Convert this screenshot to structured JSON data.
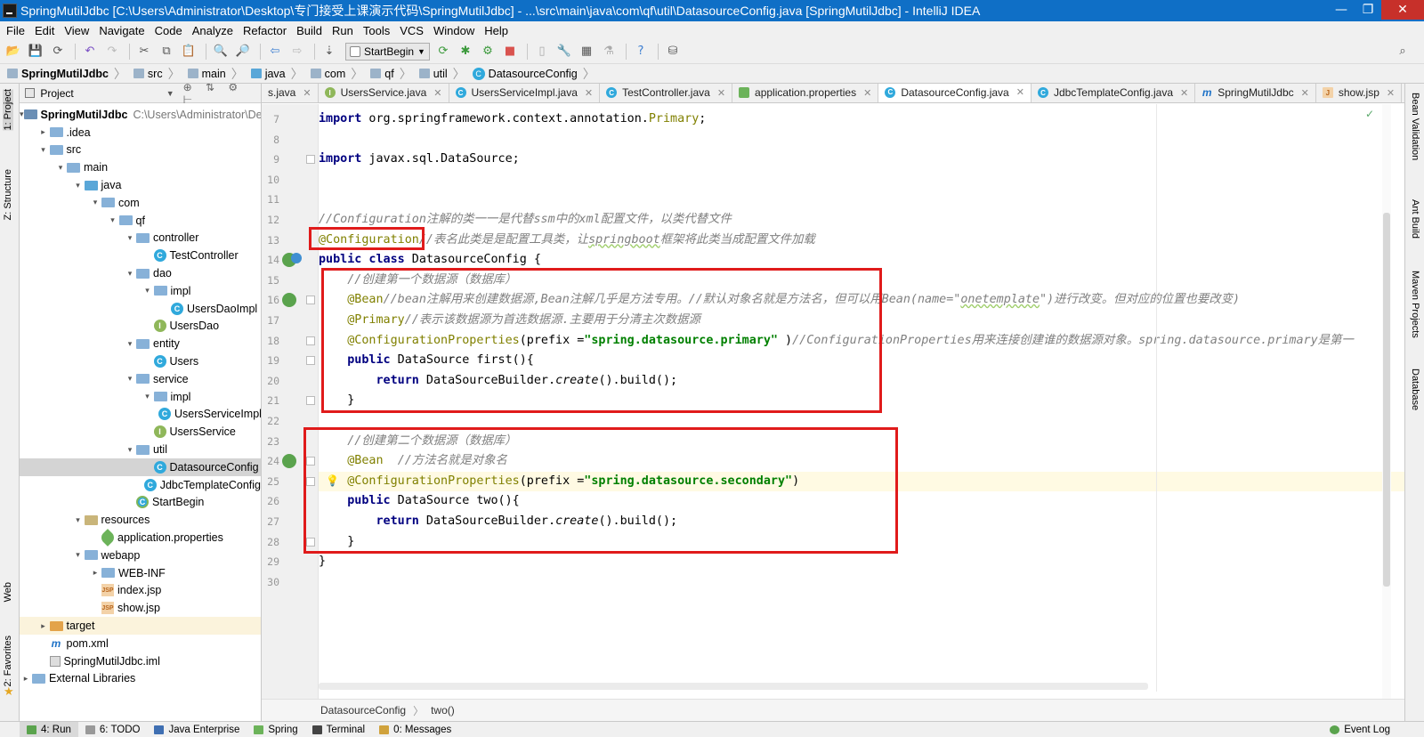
{
  "window": {
    "title": "SpringMutilJdbc [C:\\Users\\Administrator\\Desktop\\专门接受上课演示代码\\SpringMutilJdbc] - ...\\src\\main\\java\\com\\qf\\util\\DatasourceConfig.java [SpringMutilJdbc] - IntelliJ IDEA",
    "minimize": "—",
    "maximize": "❐",
    "close": "✕"
  },
  "menu": [
    "File",
    "Edit",
    "View",
    "Navigate",
    "Code",
    "Analyze",
    "Refactor",
    "Build",
    "Run",
    "Tools",
    "VCS",
    "Window",
    "Help"
  ],
  "toolbar": {
    "run_config": "StartBegin",
    "icons": [
      "open-icon",
      "save-icon",
      "sync-icon",
      "undo-icon",
      "redo-icon",
      "cut-icon",
      "copy-icon",
      "paste-icon",
      "find-icon",
      "replace-icon",
      "back-icon",
      "forward-icon",
      "make-icon",
      "run-icon",
      "debug-icon",
      "coverage-icon",
      "stop-icon",
      "settings-icon",
      "structure-icon",
      "sdk-icon",
      "help-icon",
      "vcs-icon",
      "search-icon"
    ]
  },
  "breadcrumb": [
    "SpringMutilJdbc",
    "src",
    "main",
    "java",
    "com",
    "qf",
    "util",
    "DatasourceConfig"
  ],
  "left_strip": {
    "project": "1: Project",
    "structure": "Z: Structure",
    "web": "Web",
    "favorites": "2: Favorites"
  },
  "right_strip": [
    "Bean Validation",
    "Ant Build",
    "Maven Projects",
    "Database"
  ],
  "project_panel": {
    "title": "Project",
    "tree": [
      {
        "label": "SpringMutilJdbc",
        "path": "C:\\Users\\Administrator\\Deskto",
        "depth": 0,
        "icon": "module-folder-icon",
        "arrow": "▾"
      },
      {
        "label": ".idea",
        "depth": 1,
        "icon": "folder-icon",
        "arrow": "▸"
      },
      {
        "label": "src",
        "depth": 1,
        "icon": "folder-icon",
        "arrow": "▾"
      },
      {
        "label": "main",
        "depth": 2,
        "icon": "folder-icon",
        "arrow": "▾"
      },
      {
        "label": "java",
        "depth": 3,
        "icon": "source-folder-icon",
        "arrow": "▾"
      },
      {
        "label": "com",
        "depth": 4,
        "icon": "package-icon",
        "arrow": "▾"
      },
      {
        "label": "qf",
        "depth": 5,
        "icon": "package-icon",
        "arrow": "▾"
      },
      {
        "label": "controller",
        "depth": 6,
        "icon": "package-icon",
        "arrow": "▾"
      },
      {
        "label": "TestController",
        "depth": 7,
        "icon": "class-icon",
        "arrow": ""
      },
      {
        "label": "dao",
        "depth": 6,
        "icon": "package-icon",
        "arrow": "▾"
      },
      {
        "label": "impl",
        "depth": 7,
        "icon": "package-icon",
        "arrow": "▾"
      },
      {
        "label": "UsersDaoImpl",
        "depth": 8,
        "icon": "class-icon",
        "arrow": ""
      },
      {
        "label": "UsersDao",
        "depth": 7,
        "icon": "interface-icon",
        "arrow": ""
      },
      {
        "label": "entity",
        "depth": 6,
        "icon": "package-icon",
        "arrow": "▾"
      },
      {
        "label": "Users",
        "depth": 7,
        "icon": "class-icon",
        "arrow": ""
      },
      {
        "label": "service",
        "depth": 6,
        "icon": "package-icon",
        "arrow": "▾"
      },
      {
        "label": "impl",
        "depth": 7,
        "icon": "package-icon",
        "arrow": "▾"
      },
      {
        "label": "UsersServiceImpl",
        "depth": 8,
        "icon": "class-icon",
        "arrow": ""
      },
      {
        "label": "UsersService",
        "depth": 7,
        "icon": "interface-icon",
        "arrow": ""
      },
      {
        "label": "util",
        "depth": 6,
        "icon": "package-icon",
        "arrow": "▾"
      },
      {
        "label": "DatasourceConfig",
        "depth": 7,
        "icon": "class-icon",
        "arrow": "",
        "selected": true
      },
      {
        "label": "JdbcTemplateConfig",
        "depth": 7,
        "icon": "class-icon",
        "arrow": ""
      },
      {
        "label": "StartBegin",
        "depth": 6,
        "icon": "runnable-class-icon",
        "arrow": ""
      },
      {
        "label": "resources",
        "depth": 3,
        "icon": "resources-folder-icon",
        "arrow": "▾"
      },
      {
        "label": "application.properties",
        "depth": 4,
        "icon": "spring-leaf-icon",
        "arrow": ""
      },
      {
        "label": "webapp",
        "depth": 3,
        "icon": "folder-icon",
        "arrow": "▾"
      },
      {
        "label": "WEB-INF",
        "depth": 4,
        "icon": "folder-icon",
        "arrow": "▸"
      },
      {
        "label": "index.jsp",
        "depth": 4,
        "icon": "jsp-icon",
        "arrow": ""
      },
      {
        "label": "show.jsp",
        "depth": 4,
        "icon": "jsp-icon",
        "arrow": ""
      },
      {
        "label": "target",
        "depth": 1,
        "icon": "excluded-folder-icon",
        "arrow": "▸",
        "hl": true
      },
      {
        "label": "pom.xml",
        "depth": 1,
        "icon": "maven-icon",
        "arrow": ""
      },
      {
        "label": "SpringMutilJdbc.iml",
        "depth": 1,
        "icon": "iml-icon",
        "arrow": ""
      },
      {
        "label": "External Libraries",
        "depth": 0,
        "icon": "libraries-icon",
        "arrow": "▸"
      }
    ]
  },
  "tabs": [
    {
      "label": "s.java",
      "icon": "c",
      "active": false
    },
    {
      "label": "UsersService.java",
      "icon": "i",
      "active": false
    },
    {
      "label": "UsersServiceImpl.java",
      "icon": "c",
      "active": false
    },
    {
      "label": "TestController.java",
      "icon": "c",
      "active": false
    },
    {
      "label": "application.properties",
      "icon": "p",
      "active": false
    },
    {
      "label": "DatasourceConfig.java",
      "icon": "c",
      "active": true
    },
    {
      "label": "JdbcTemplateConfig.java",
      "icon": "c",
      "active": false
    },
    {
      "label": "SpringMutilJdbc",
      "icon": "m",
      "active": false
    },
    {
      "label": "show.jsp",
      "icon": "j",
      "active": false
    }
  ],
  "tabs_overflow": "≡₈",
  "editor": {
    "lines": [
      {
        "n": "7",
        "html": "<span class=\"kw\">import</span> org.springframework.context.annotation.<span class=\"an\">Primary</span>;"
      },
      {
        "n": "8",
        "html": ""
      },
      {
        "n": "9",
        "html": "<span class=\"kw\">import</span> javax.sql.DataSource;"
      },
      {
        "n": "10",
        "html": ""
      },
      {
        "n": "11",
        "html": ""
      },
      {
        "n": "12",
        "html": "<span class=\"cm\">//Configuration注解的类一一是代替ssm中的xml配置文件，以类代替文件</span>"
      },
      {
        "n": "13",
        "html": "<span class=\"an\">@Configuration</span><span class=\"cm\">//表名此类是是配置工具类，让<span class=\"ul\">springboot</span>框架将此类当成配置文件加载</span>"
      },
      {
        "n": "14",
        "html": "<span class=\"kw\">public class</span> DatasourceConfig {"
      },
      {
        "n": "15",
        "html": "    <span class=\"cm\">//创建第一个数据源（数据库）</span>"
      },
      {
        "n": "16",
        "html": "    <span class=\"an\">@Bean</span><span class=\"cm\">//bean注解用来创建数据源,Bean注解几乎是方法专用。//默认对象名就是方法名，但可以用Bean(name=\"<span class=\"ul\">onetemplate</span>\")进行改变。但对应的位置也要改变)</span>"
      },
      {
        "n": "17",
        "html": "    <span class=\"an\">@Primary</span><span class=\"cm\">//表示该数据源为首选数据源.主要用于分清主次数据源</span>"
      },
      {
        "n": "18",
        "html": "    <span class=\"an\">@ConfigurationProperties</span>(prefix =<span class=\"st\">\"spring.datasource.primary\"</span> )<span class=\"cm\">//ConfigurationProperties用来连接创建谁的数据源对象。spring.datasource.primary是第一</span>"
      },
      {
        "n": "19",
        "html": "    <span class=\"kw\">public</span> DataSource first(){"
      },
      {
        "n": "20",
        "html": "        <span class=\"kw\">return</span> DataSourceBuilder.<span class=\"it\">create</span>().build();"
      },
      {
        "n": "21",
        "html": "    }"
      },
      {
        "n": "22",
        "html": ""
      },
      {
        "n": "23",
        "html": "    <span class=\"cm\">//创建第二个数据源（数据库）</span>"
      },
      {
        "n": "24",
        "html": "    <span class=\"an\">@Bean</span>  <span class=\"cm\">//方法名就是对象名</span>"
      },
      {
        "n": "25",
        "html": "    <span class=\"an\">@ConfigurationProperties</span>(prefix =<span class=\"st\">\"spring.datasource.secondary\"</span>)"
      },
      {
        "n": "26",
        "html": "    <span class=\"kw\">public</span> DataSource two(){"
      },
      {
        "n": "27",
        "html": "        <span class=\"kw\">return</span> DataSourceBuilder.<span class=\"it\">create</span>().build();"
      },
      {
        "n": "28",
        "html": "    }"
      },
      {
        "n": "29",
        "html": "}"
      },
      {
        "n": "30",
        "html": ""
      }
    ],
    "breadcrumb": [
      "DatasourceConfig",
      "two()"
    ]
  },
  "bottom_tabs": [
    "4: Run",
    "6: TODO",
    "Java Enterprise",
    "Spring",
    "Terminal",
    "0: Messages"
  ],
  "event_log": "Event Log",
  "colors": {
    "accent": "#0f6fc6",
    "annotation": "#808000",
    "keyword": "#000080",
    "string": "#008000",
    "comment": "#808080",
    "highlight_box": "#e01b1b"
  }
}
